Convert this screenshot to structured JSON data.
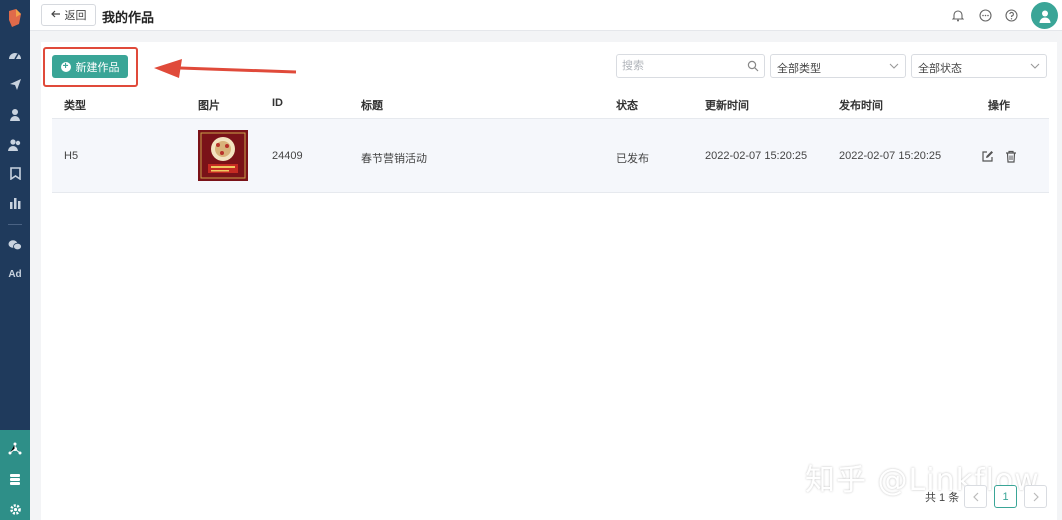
{
  "header": {
    "back_label": "返回",
    "title": "我的作品",
    "icons": [
      "bell-icon",
      "chat-icon",
      "help-icon",
      "user-avatar"
    ]
  },
  "sidebar": {
    "icons": [
      "dashboard-icon",
      "send-icon",
      "user-icon",
      "users-icon",
      "bookmark-icon",
      "bar-chart-icon",
      "wechat-icon",
      "ad-icon",
      "network-icon",
      "database-icon",
      "settings-icon"
    ],
    "ad_label": "Ad"
  },
  "toolbar": {
    "new_label": "新建作品",
    "search_placeholder": "搜索",
    "type_filter": "全部类型",
    "status_filter": "全部状态"
  },
  "table": {
    "columns": [
      "类型",
      "图片",
      "ID",
      "标题",
      "状态",
      "更新时间",
      "发布时间",
      "操作"
    ],
    "rows": [
      {
        "type": "H5",
        "image": "spring-festival-poster",
        "id": "24409",
        "title": "春节营销活动",
        "status": "已发布",
        "updated": "2022-02-07 15:20:25",
        "published": "2022-02-07 15:20:25"
      }
    ]
  },
  "pagination": {
    "total": "共 1 条",
    "current": "1"
  },
  "watermark": "知乎 @Linkflow",
  "colors": {
    "sidebar": "#1f3a5c",
    "accent": "#3aa597",
    "highlight": "#e04a3a"
  }
}
